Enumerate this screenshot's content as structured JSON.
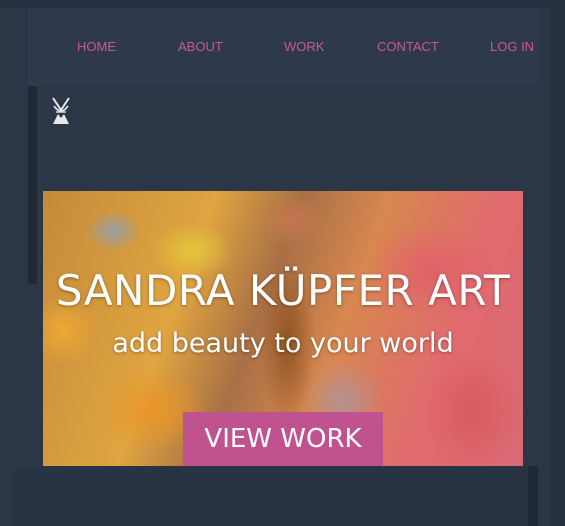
{
  "nav": {
    "items": [
      {
        "label": "HOME"
      },
      {
        "label": "ABOUT"
      },
      {
        "label": "WORK"
      },
      {
        "label": "CONTACT"
      },
      {
        "label": "LOG IN"
      }
    ]
  },
  "hero": {
    "title": "SANDRA KÜPFER ART",
    "subtitle": "add beauty to your world",
    "button_label": "VIEW WORK"
  },
  "colors": {
    "background": "#2b3647",
    "nav_link": "#c9569d",
    "button": "#c0538f",
    "hero_text": "#ffffff"
  },
  "icons": {
    "logo": "abstract-figure-logo-icon"
  }
}
